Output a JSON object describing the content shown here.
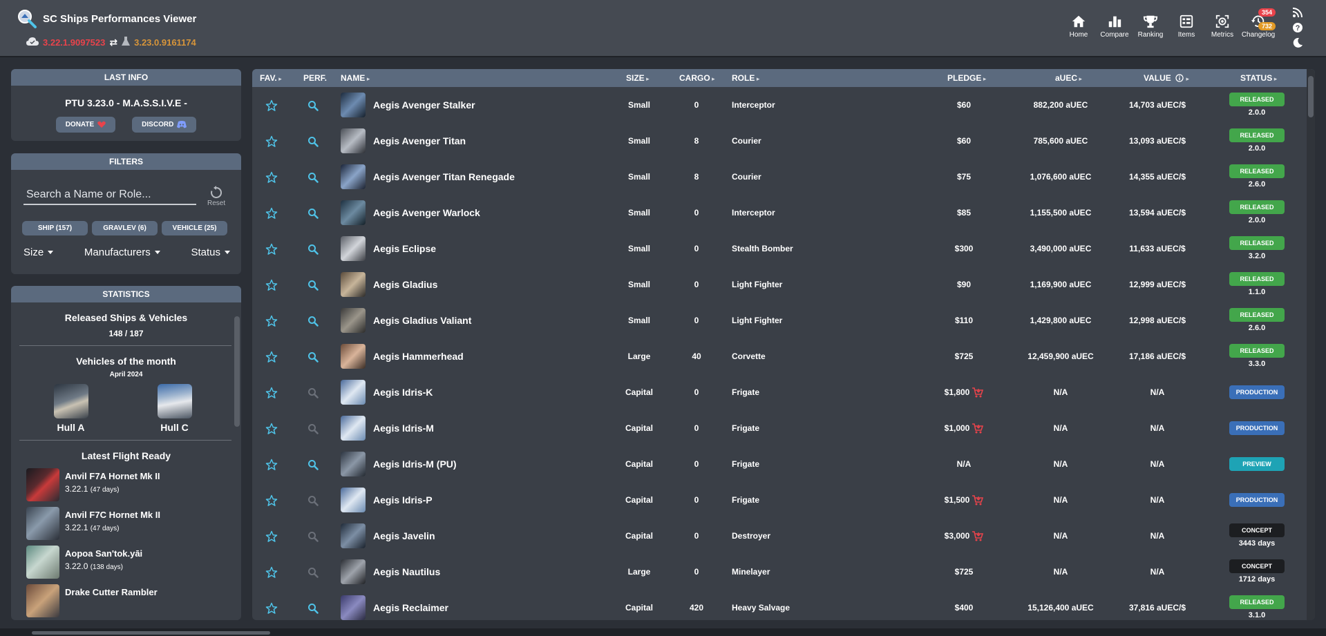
{
  "app": {
    "title": "SC Ships Performances Viewer",
    "live_version": "3.22.1.9097523",
    "ptu_version": "3.23.0.9161174"
  },
  "nav": [
    {
      "label": "Home",
      "icon": "home-icon"
    },
    {
      "label": "Compare",
      "icon": "bar-chart-icon"
    },
    {
      "label": "Ranking",
      "icon": "trophy-icon"
    },
    {
      "label": "Items",
      "icon": "items-icon"
    },
    {
      "label": "Metrics",
      "icon": "metrics-icon"
    },
    {
      "label": "Changelog",
      "icon": "history-icon"
    }
  ],
  "badges": {
    "red": "354",
    "orange": "732"
  },
  "last_info": {
    "header": "LAST INFO",
    "text": "PTU 3.23.0 - M.A.S.S.I.V.E -",
    "donate": "DONATE",
    "discord": "DISCORD"
  },
  "filters": {
    "header": "FILTERS",
    "search_placeholder": "Search a Name or Role...",
    "reset": "Reset",
    "chips": [
      "SHIP (157)",
      "GRAVLEV (6)",
      "VEHICLE (25)"
    ],
    "dropdowns": [
      "Size",
      "Manufacturers",
      "Status"
    ]
  },
  "statistics": {
    "header": "STATISTICS",
    "released_title": "Released Ships & Vehicles",
    "released_count": "148 / 187",
    "vom_title": "Vehicles of the month",
    "vom_date": "April 2024",
    "vom": [
      "Hull A",
      "Hull C"
    ],
    "lfr_title": "Latest Flight Ready",
    "lfr": [
      {
        "name": "Anvil F7A Hornet Mk II",
        "version": "3.22.1",
        "age": "(47 days)"
      },
      {
        "name": "Anvil F7C Hornet Mk II",
        "version": "3.22.1",
        "age": "(47 days)"
      },
      {
        "name": "Aopoa San'tok.yāi",
        "version": "3.22.0",
        "age": "(138 days)"
      },
      {
        "name": "Drake Cutter Rambler",
        "version": "",
        "age": ""
      }
    ]
  },
  "table": {
    "headers": {
      "fav": "FAV.",
      "perf": "PERF.",
      "name": "NAME",
      "size": "SIZE",
      "cargo": "CARGO",
      "role": "ROLE",
      "pledge": "PLEDGE",
      "auec": "aUEC",
      "value": "VALUE",
      "status": "STATUS"
    },
    "rows": [
      {
        "name": "Aegis Avenger Stalker",
        "size": "Small",
        "cargo": "0",
        "role": "Interceptor",
        "pledge": "$60",
        "cart": false,
        "auec": "882,200 aUEC",
        "value": "14,703 aUEC/$",
        "status": "RELEASED",
        "status_sub": "2.0.0",
        "perf": true
      },
      {
        "name": "Aegis Avenger Titan",
        "size": "Small",
        "cargo": "8",
        "role": "Courier",
        "pledge": "$60",
        "cart": false,
        "auec": "785,600 aUEC",
        "value": "13,093 aUEC/$",
        "status": "RELEASED",
        "status_sub": "2.0.0",
        "perf": true
      },
      {
        "name": "Aegis Avenger Titan Renegade",
        "size": "Small",
        "cargo": "8",
        "role": "Courier",
        "pledge": "$75",
        "cart": false,
        "auec": "1,076,600 aUEC",
        "value": "14,355 aUEC/$",
        "status": "RELEASED",
        "status_sub": "2.6.0",
        "perf": true
      },
      {
        "name": "Aegis Avenger Warlock",
        "size": "Small",
        "cargo": "0",
        "role": "Interceptor",
        "pledge": "$85",
        "cart": false,
        "auec": "1,155,500 aUEC",
        "value": "13,594 aUEC/$",
        "status": "RELEASED",
        "status_sub": "2.0.0",
        "perf": true
      },
      {
        "name": "Aegis Eclipse",
        "size": "Small",
        "cargo": "0",
        "role": "Stealth Bomber",
        "pledge": "$300",
        "cart": false,
        "auec": "3,490,000 aUEC",
        "value": "11,633 aUEC/$",
        "status": "RELEASED",
        "status_sub": "3.2.0",
        "perf": true
      },
      {
        "name": "Aegis Gladius",
        "size": "Small",
        "cargo": "0",
        "role": "Light Fighter",
        "pledge": "$90",
        "cart": false,
        "auec": "1,169,900 aUEC",
        "value": "12,999 aUEC/$",
        "status": "RELEASED",
        "status_sub": "1.1.0",
        "perf": true
      },
      {
        "name": "Aegis Gladius Valiant",
        "size": "Small",
        "cargo": "0",
        "role": "Light Fighter",
        "pledge": "$110",
        "cart": false,
        "auec": "1,429,800 aUEC",
        "value": "12,998 aUEC/$",
        "status": "RELEASED",
        "status_sub": "2.6.0",
        "perf": true
      },
      {
        "name": "Aegis Hammerhead",
        "size": "Large",
        "cargo": "40",
        "role": "Corvette",
        "pledge": "$725",
        "cart": false,
        "auec": "12,459,900 aUEC",
        "value": "17,186 aUEC/$",
        "status": "RELEASED",
        "status_sub": "3.3.0",
        "perf": true
      },
      {
        "name": "Aegis Idris-K",
        "size": "Capital",
        "cargo": "0",
        "role": "Frigate",
        "pledge": "$1,800",
        "cart": true,
        "auec": "N/A",
        "value": "N/A",
        "status": "PRODUCTION",
        "status_sub": "",
        "perf": false
      },
      {
        "name": "Aegis Idris-M",
        "size": "Capital",
        "cargo": "0",
        "role": "Frigate",
        "pledge": "$1,000",
        "cart": true,
        "auec": "N/A",
        "value": "N/A",
        "status": "PRODUCTION",
        "status_sub": "",
        "perf": false
      },
      {
        "name": "Aegis Idris-M (PU)",
        "size": "Capital",
        "cargo": "0",
        "role": "Frigate",
        "pledge": "N/A",
        "cart": false,
        "auec": "N/A",
        "value": "N/A",
        "status": "PREVIEW",
        "status_sub": "",
        "perf": true
      },
      {
        "name": "Aegis Idris-P",
        "size": "Capital",
        "cargo": "0",
        "role": "Frigate",
        "pledge": "$1,500",
        "cart": true,
        "auec": "N/A",
        "value": "N/A",
        "status": "PRODUCTION",
        "status_sub": "",
        "perf": false
      },
      {
        "name": "Aegis Javelin",
        "size": "Capital",
        "cargo": "0",
        "role": "Destroyer",
        "pledge": "$3,000",
        "cart": true,
        "auec": "N/A",
        "value": "N/A",
        "status": "CONCEPT",
        "status_sub": "3443 days",
        "perf": false
      },
      {
        "name": "Aegis Nautilus",
        "size": "Large",
        "cargo": "0",
        "role": "Minelayer",
        "pledge": "$725",
        "cart": false,
        "auec": "N/A",
        "value": "N/A",
        "status": "CONCEPT",
        "status_sub": "1712 days",
        "perf": false
      },
      {
        "name": "Aegis Reclaimer",
        "size": "Capital",
        "cargo": "420",
        "role": "Heavy Salvage",
        "pledge": "$400",
        "cart": false,
        "auec": "15,126,400 aUEC",
        "value": "37,816 aUEC/$",
        "status": "RELEASED",
        "status_sub": "3.1.0",
        "perf": true
      }
    ]
  },
  "colors": {
    "topbar": "#454a52",
    "panel": "#3a3f47",
    "panel_header": "#5b6a7e",
    "live_version": "#e9434b",
    "ptu_version": "#d7953a",
    "released": "#43a64b",
    "production": "#3a6fb8",
    "preview": "#1ea3b5",
    "concept": "#1c1e21",
    "icon_blue": "#4fc3e8"
  }
}
